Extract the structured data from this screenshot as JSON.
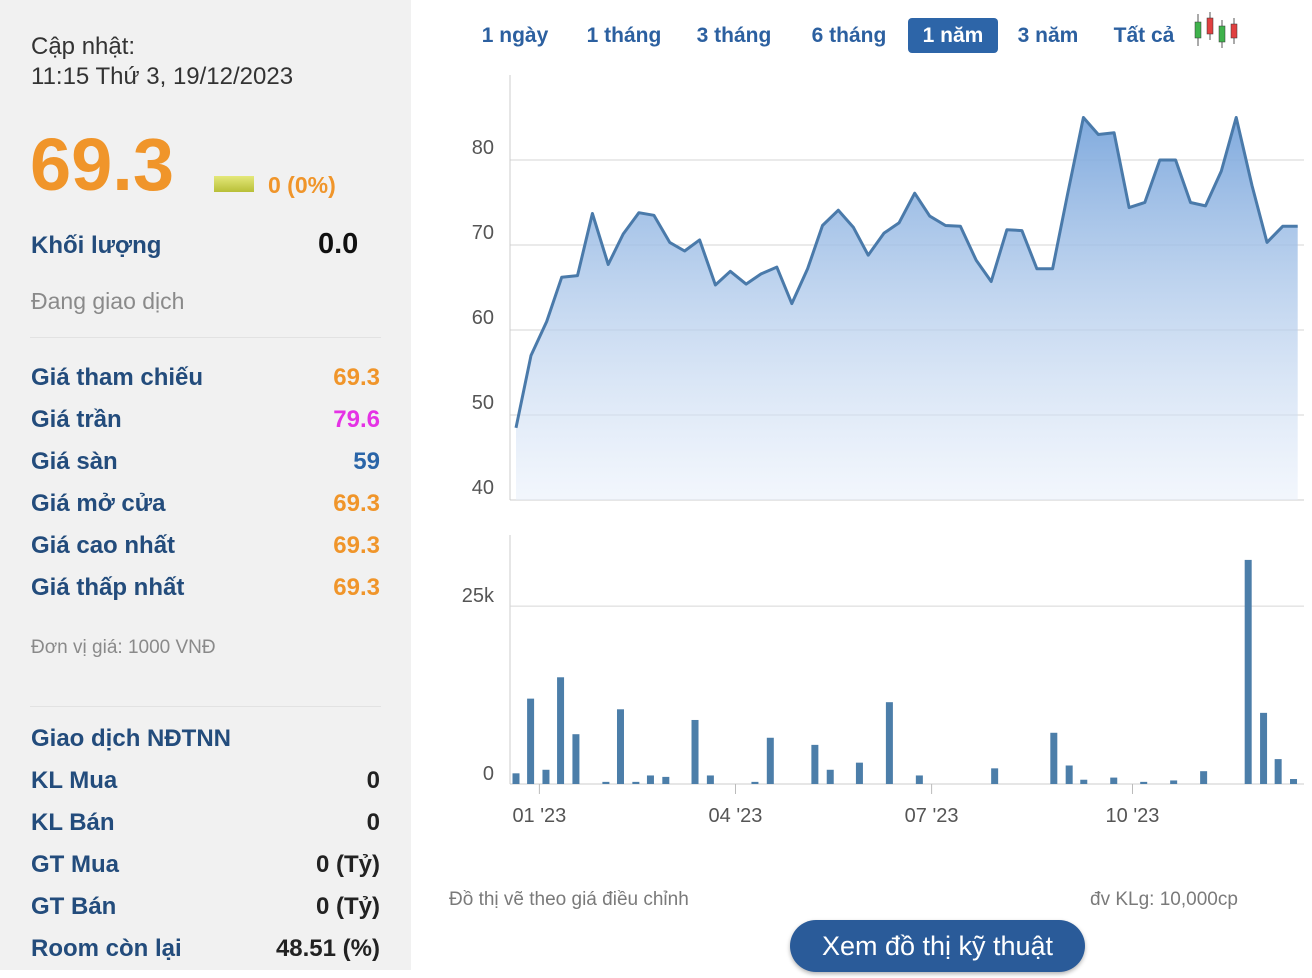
{
  "stock": {
    "updated_label": "Cập nhật:",
    "updated_time": "11:15 Thứ 3, 19/12/2023",
    "price": "69.3",
    "change": "0 (0%)",
    "volume_label": "Khối lượng",
    "volume_value": "0.0",
    "status": "Đang giao dịch",
    "rows": [
      {
        "label": "Giá tham chiếu",
        "value": "69.3",
        "color": "#f0952a"
      },
      {
        "label": "Giá trần",
        "value": "79.6",
        "color": "#e532e5"
      },
      {
        "label": "Giá sàn",
        "value": "59",
        "color": "#2a65a8"
      },
      {
        "label": "Giá mở cửa",
        "value": "69.3",
        "color": "#f0952a"
      },
      {
        "label": "Giá cao nhất",
        "value": "69.3",
        "color": "#f0952a"
      },
      {
        "label": "Giá thấp nhất",
        "value": "69.3",
        "color": "#f0952a"
      }
    ],
    "unit_note": "Đơn vị giá: 1000 VNĐ",
    "foreign_title": "Giao dịch NĐTNN",
    "foreign_rows": [
      {
        "label": "KL Mua",
        "value": "0"
      },
      {
        "label": "KL Bán",
        "value": "0"
      },
      {
        "label": "GT Mua",
        "value": "0 (Tỷ)"
      },
      {
        "label": "GT Bán",
        "value": "0 (Tỷ)"
      },
      {
        "label": "Room còn lại",
        "value": "48.51 (%)"
      }
    ]
  },
  "tabs": [
    "1 ngày",
    "1 tháng",
    "3 tháng",
    "6 tháng",
    "1 năm",
    "3 năm",
    "Tất cả"
  ],
  "active_tab": "1 năm",
  "candle_icon": "candlestick-icon",
  "colors": {
    "accent": "#2d65a8",
    "price": "#f0952a",
    "ceiling": "#e532e5",
    "line": "#4a7aaa",
    "bar": "#4c7ea9"
  },
  "notes": {
    "adjusted": "Đồ thị vẽ theo giá điều chỉnh",
    "volume_unit": "đv KLg: 10,000cp"
  },
  "tech_button": "Xem đồ thị kỹ thuật",
  "chart_data": [
    {
      "type": "area",
      "ylim": [
        40,
        90
      ],
      "yticks": [
        "40",
        "50",
        "60",
        "70",
        "80"
      ],
      "xlim": [
        0,
        1
      ],
      "x": [
        0.0,
        0.019,
        0.039,
        0.058,
        0.078,
        0.097,
        0.117,
        0.136,
        0.156,
        0.175,
        0.195,
        0.214,
        0.233,
        0.253,
        0.272,
        0.292,
        0.311,
        0.331,
        0.35,
        0.37,
        0.389,
        0.409,
        0.428,
        0.447,
        0.467,
        0.486,
        0.506,
        0.525,
        0.545,
        0.564,
        0.584,
        0.603,
        0.623,
        0.642,
        0.661,
        0.681,
        0.7,
        0.72,
        0.739,
        0.759,
        0.778,
        0.798,
        0.817,
        0.837,
        0.856,
        0.875,
        0.895,
        0.914,
        0.934,
        0.953,
        0.973,
        0.992
      ],
      "values": [
        48.5,
        57,
        61,
        66.2,
        66.4,
        73.7,
        67.7,
        71.3,
        73.8,
        73.5,
        70.3,
        69.3,
        70.6,
        65.3,
        66.9,
        65.4,
        66.6,
        67.4,
        63.1,
        67.2,
        72.3,
        74.1,
        72.1,
        68.8,
        71.4,
        72.6,
        76.1,
        73.4,
        72.3,
        72.2,
        68.2,
        65.7,
        71.8,
        71.7,
        67.2,
        67.2,
        76,
        85,
        83,
        83.2,
        74.4,
        75,
        80,
        80,
        75,
        74.6,
        78.7,
        85,
        77,
        70.3,
        72.2,
        72.2
      ],
      "last_value": 69.3
    },
    {
      "type": "bar",
      "ylim": [
        0,
        35
      ],
      "yticks": [
        "0",
        "25k"
      ],
      "xticks": [
        {
          "label": "01 '23",
          "pos": 0.037
        },
        {
          "label": "04 '23",
          "pos": 0.284
        },
        {
          "label": "07 '23",
          "pos": 0.531
        },
        {
          "label": "10 '23",
          "pos": 0.784
        }
      ],
      "x": [
        0,
        0.019,
        0.039,
        0.058,
        0.078,
        0.117,
        0.136,
        0.156,
        0.175,
        0.195,
        0.233,
        0.253,
        0.311,
        0.331,
        0.389,
        0.409,
        0.447,
        0.486,
        0.525,
        0.623,
        0.7,
        0.72,
        0.739,
        0.778,
        0.817,
        0.856,
        0.895,
        0.953,
        0.973,
        0.992,
        1.012,
        1.031
      ],
      "values": [
        1.5,
        12,
        2,
        15,
        7,
        0.3,
        10.5,
        0.3,
        1.2,
        1,
        9,
        1.2,
        0.3,
        6.5,
        5.5,
        2,
        3,
        11.5,
        1.2,
        2.2,
        7.2,
        2.6,
        0.6,
        0.9,
        0.3,
        0.5,
        1.8,
        31.5,
        10,
        3.5,
        0.7,
        0
      ]
    }
  ]
}
